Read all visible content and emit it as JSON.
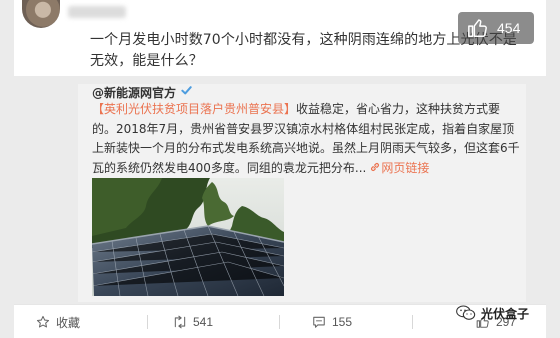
{
  "comment": {
    "text": "一个月发电小时数70个小时都没有，这种阴雨连绵的地方上光伏不是无效，能是什么？",
    "like_count": "454"
  },
  "repost": {
    "author": "@新能源网官方",
    "topic": "【英利光伏扶贫项目落户贵州普安县】",
    "body": "收益稳定，省心省力，这种扶贫方式要的。2018年7月，贵州省普安县罗汉镇凉水村格体组村民张定成，指着自家屋顶上新装快一个月的分布式发电系统高兴地说。虽然上月阴雨天气较多，但这套6千瓦的系统仍然发电400多度。同组的袁龙元把分布...",
    "link_label": "网页链接"
  },
  "actions": {
    "favorite_label": "收藏",
    "repost_count": "541",
    "comment_count": "155",
    "like_count": "297"
  },
  "watermark": {
    "label": "光伏盒子"
  },
  "colors": {
    "accent": "#eb7350",
    "verified": "#4e9ddf"
  }
}
